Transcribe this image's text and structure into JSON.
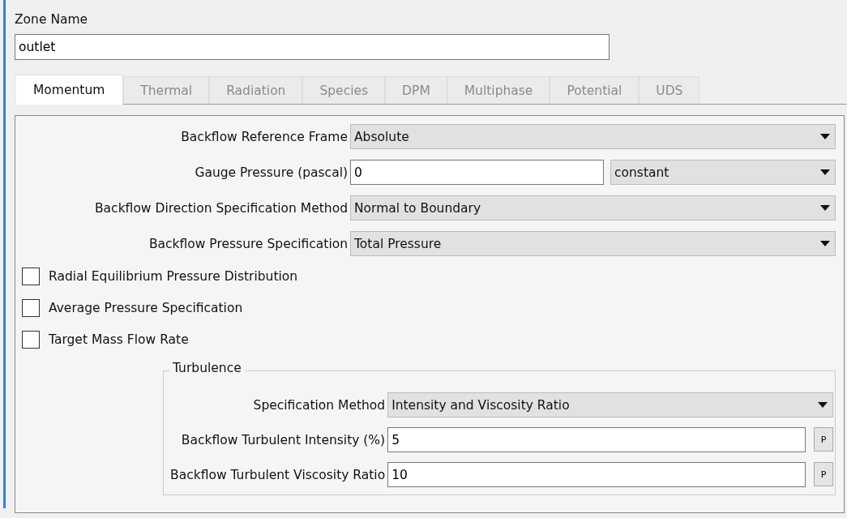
{
  "zone_name": {
    "label": "Zone Name",
    "value": "outlet"
  },
  "tabs": [
    {
      "label": "Momentum",
      "selected": true
    },
    {
      "label": "Thermal",
      "selected": false
    },
    {
      "label": "Radiation",
      "selected": false
    },
    {
      "label": "Species",
      "selected": false
    },
    {
      "label": "DPM",
      "selected": false
    },
    {
      "label": "Multiphase",
      "selected": false
    },
    {
      "label": "Potential",
      "selected": false
    },
    {
      "label": "UDS",
      "selected": false
    }
  ],
  "fields": [
    {
      "kind": "dropdown",
      "label": "Backflow Reference Frame",
      "value": "Absolute"
    },
    {
      "kind": "input_dropdown",
      "label": "Gauge Pressure (pascal)",
      "value": "0",
      "option": "constant"
    },
    {
      "kind": "dropdown",
      "label": "Backflow Direction Specification Method",
      "value": "Normal to Boundary"
    },
    {
      "kind": "dropdown",
      "label": "Backflow Pressure Specification",
      "value": "Total Pressure"
    }
  ],
  "checkboxes": [
    {
      "label": "Radial Equilibrium Pressure Distribution",
      "checked": false
    },
    {
      "label": "Average Pressure Specification",
      "checked": false
    },
    {
      "label": "Target Mass Flow Rate",
      "checked": false
    }
  ],
  "turbulence": {
    "title": "Turbulence",
    "fields": [
      {
        "kind": "dropdown",
        "label": "Specification Method",
        "value": "Intensity and Viscosity Ratio"
      },
      {
        "kind": "input_param",
        "label": "Backflow Turbulent Intensity (%)",
        "value": "5",
        "button": "P"
      },
      {
        "kind": "input_param",
        "label": "Backflow Turbulent Viscosity Ratio",
        "value": "10",
        "button": "P"
      }
    ]
  }
}
